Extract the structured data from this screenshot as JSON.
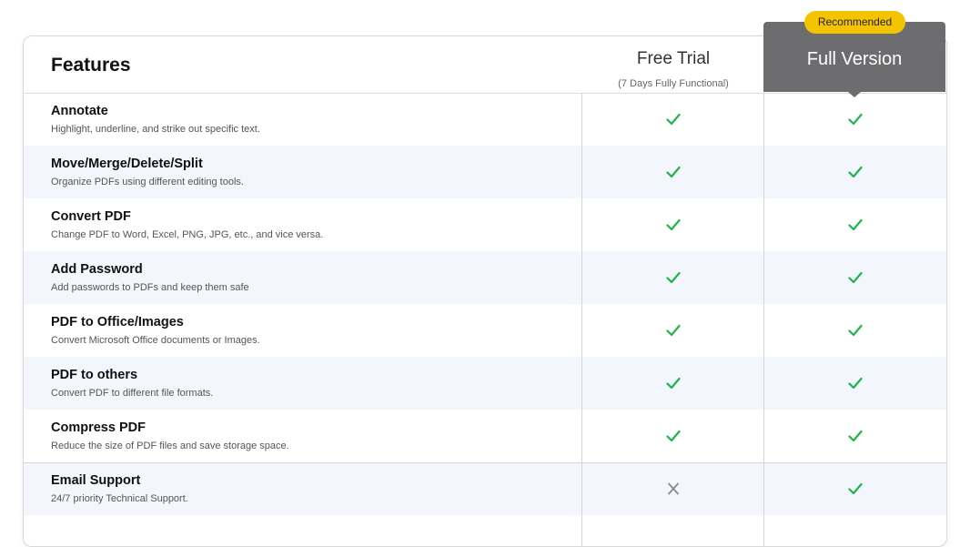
{
  "header": {
    "features_label": "Features",
    "free_trial": {
      "title": "Free Trial",
      "subtitle": "(7 Days Fully Functional)"
    },
    "full_version": {
      "title": "Full Version",
      "badge": "Recommended",
      "color": "#6d6d70",
      "badge_color": "#f5c400"
    }
  },
  "check_color": "#1fb54a",
  "cross_color": "#8a8a8a",
  "rows": [
    {
      "title": "Annotate",
      "desc": "Highlight, underline, and strike out specific text.",
      "free": "check-icon",
      "full": "check-icon"
    },
    {
      "title": "Move/Merge/Delete/Split",
      "desc": "Organize PDFs using different editing tools.",
      "free": "check-icon",
      "full": "check-icon"
    },
    {
      "title": "Convert PDF",
      "desc": "Change PDF to Word, Excel, PNG, JPG, etc., and vice versa.",
      "free": "check-icon",
      "full": "check-icon"
    },
    {
      "title": "Add Password",
      "desc": "Add passwords to PDFs and keep them safe",
      "free": "check-icon",
      "full": "check-icon"
    },
    {
      "title": "PDF to Office/Images",
      "desc": "Convert Microsoft Office documents or Images.",
      "free": "check-icon",
      "full": "check-icon"
    },
    {
      "title": "PDF to others",
      "desc": "Convert PDF to different file formats.",
      "free": "check-icon",
      "full": "check-icon"
    },
    {
      "title": "Compress PDF",
      "desc": "Reduce the size of PDF files and save storage space.",
      "free": "check-icon",
      "full": "check-icon"
    },
    {
      "title": "Email Support",
      "desc": "24/7 priority Technical Support.",
      "free": "cross-icon",
      "full": "check-icon"
    }
  ]
}
